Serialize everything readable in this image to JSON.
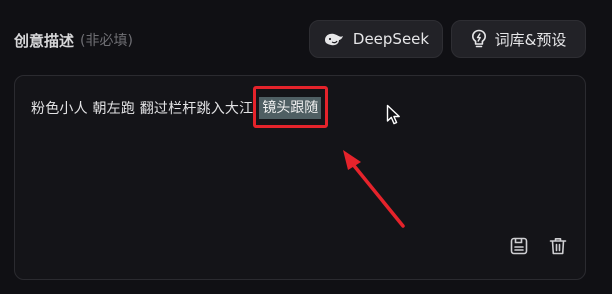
{
  "section": {
    "title": "创意描述",
    "subtitle": "(非必填)"
  },
  "buttons": {
    "deepseek_label": "DeepSeek",
    "deepseek_icon": "whale-icon",
    "preset_label": "词库&预设",
    "preset_icon": "lightbulb-icon"
  },
  "editor": {
    "text_plain": "粉色小人 朝左跑 翻过栏杆跳入大江",
    "text_selected": "镜头跟随",
    "selection_highlight_color": "#4f5f63",
    "actions": {
      "save_icon": "save-icon",
      "delete_icon": "trash-icon"
    }
  },
  "annotation": {
    "color": "#e5232b"
  },
  "colors": {
    "background": "#101014",
    "button_bg": "#222227",
    "text_primary": "#e3e3e5",
    "text_muted": "#6f6f74"
  }
}
